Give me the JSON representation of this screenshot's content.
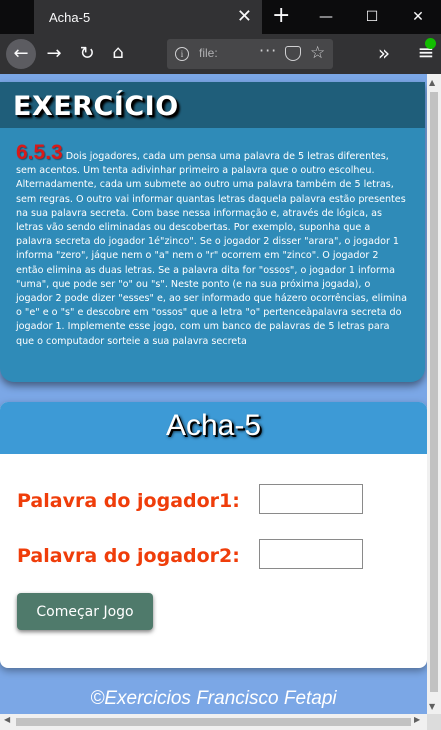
{
  "browser": {
    "tab_title": "Acha-5",
    "tab_close": "✕",
    "new_tab": "+",
    "url": "file:",
    "minimize": "—",
    "maximize": "☐",
    "close": "✕",
    "overflow": "»",
    "menu": "≡"
  },
  "exercise": {
    "title": "EXERCÍCIO",
    "number": "6.5.3",
    "text": " Dois jogadores, cada um pensa uma palavra de 5 letras diferentes, sem acentos. Um tenta adivinhar primeiro a palavra que o outro escolheu. Alternadamente, cada um submete ao outro uma palavra também de 5 letras, sem regras. O outro vai informar quantas letras daquela palavra estão presentes na sua palavra secreta. Com base nessa informação e, através de lógica, as letras vão sendo eliminadas ou descobertas. Por exemplo, suponha que a palavra secreta do jogador 1é\"zinco\". Se o jogador 2 disser \"arara\", o jogador 1 informa \"zero\", jáque nem o \"a\" nem o \"r\" ocorrem em \"zinco\". O jogador 2 então elimina as duas letras. Se a palavra dita for \"ossos\", o jogador 1 informa \"uma\", que pode ser \"o\" ou \"s\". Neste ponto (e na sua próxima jogada), o jogador 2 pode dizer \"esses\" e, ao ser informado que házero ocorrências, elimina o \"e\" e o \"s\" e descobre em \"ossos\" que a letra \"o\" pertenceàpalavra secreta do jogador 1. Implemente esse jogo, com um banco de palavras de 5 letras para que o computador sorteie a sua palavra secreta"
  },
  "game": {
    "title": "Acha-5",
    "player1_label": "Palavra do jogador1:",
    "player1_value": "",
    "player2_label": "Palavra do jogador2:",
    "player2_value": "",
    "start_button": "Começar Jogo"
  },
  "footer": {
    "text": "©Exercicios Francisco Fetapi"
  },
  "colors": {
    "page_bg": "#7ba7e6",
    "exercise_bg": "#2f8bb8",
    "exercise_header": "#1f5e7a",
    "exercise_number": "#d81a1a",
    "game_header": "#3d9ad6",
    "label": "#ef3d0a",
    "button": "#4f7a6b"
  }
}
